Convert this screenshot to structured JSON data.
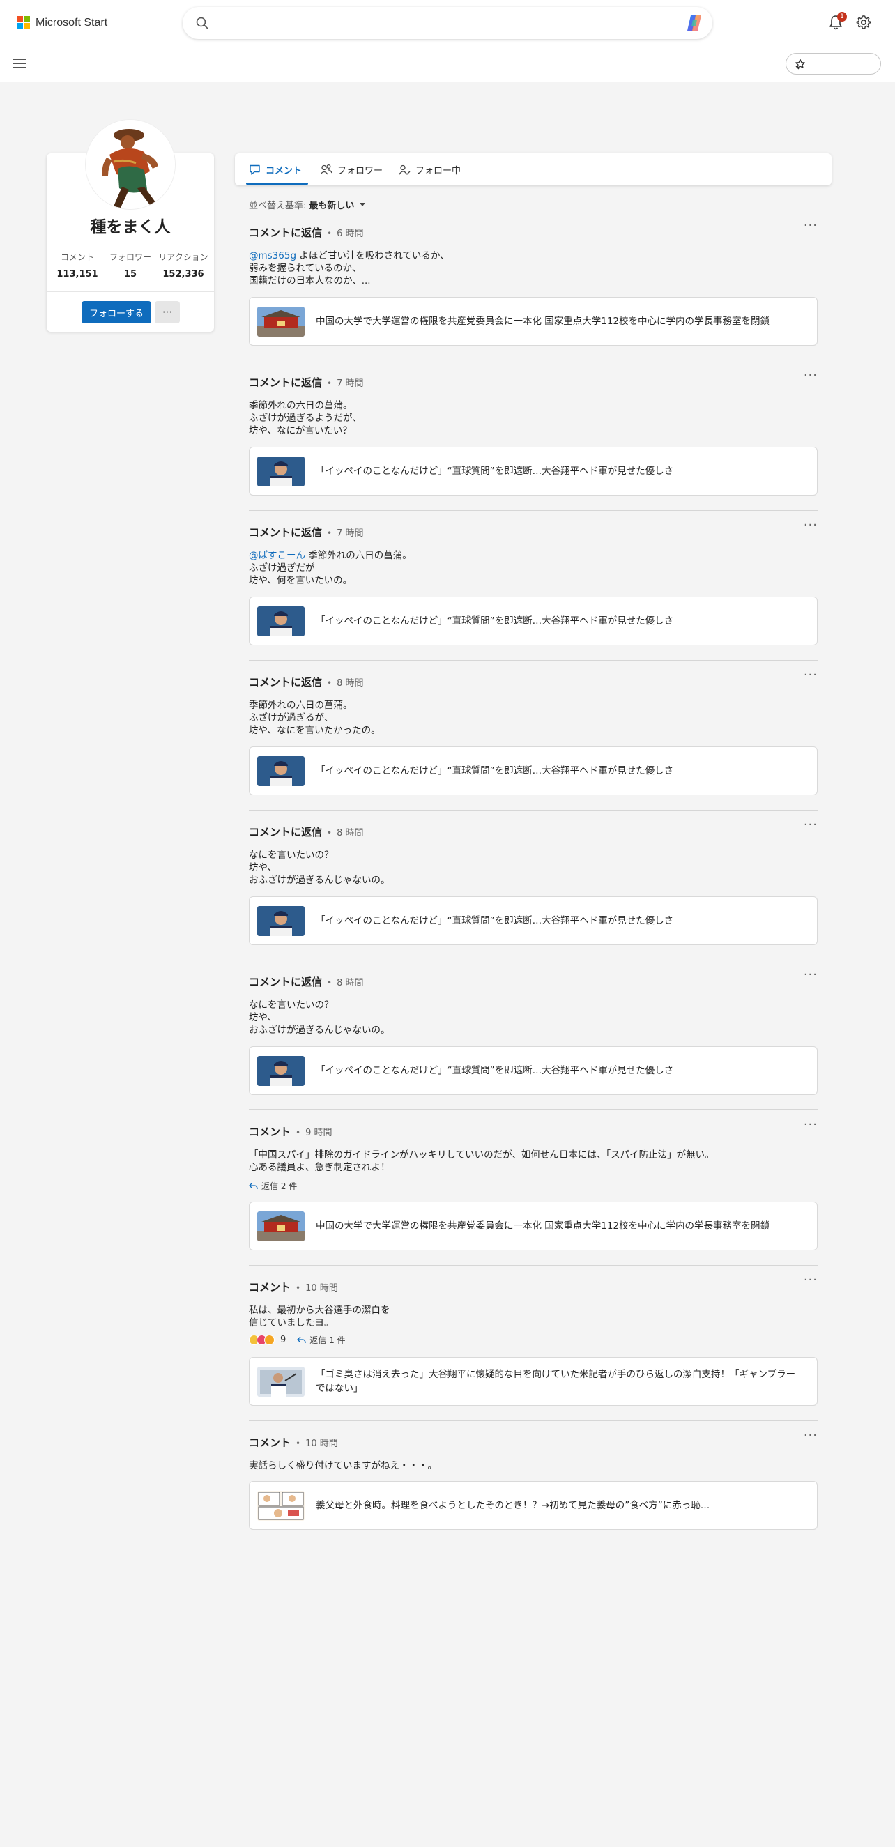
{
  "header": {
    "brand": "Microsoft Start",
    "brand_colors": [
      "#f25022",
      "#7fba00",
      "#00a4ef",
      "#ffb900"
    ],
    "search_icon": "search-icon",
    "copilot_icon": "copilot-icon",
    "notification_count": "1",
    "settings_icon": "gear-icon"
  },
  "subheader": {
    "menu_icon": "hamburger-icon",
    "favorites_icon": "star-icon"
  },
  "profile": {
    "name": "種をまく人",
    "stats": [
      {
        "label": "コメント",
        "value": "113,151"
      },
      {
        "label": "フォロワー",
        "value": "15"
      },
      {
        "label": "リアクション",
        "value": "152,336"
      }
    ],
    "follow_label": "フォローする",
    "more_label": "···"
  },
  "tabs": [
    {
      "label": "コメント",
      "icon": "comment-icon",
      "active": true
    },
    {
      "label": "フォロワー",
      "icon": "followers-icon",
      "active": false
    },
    {
      "label": "フォロー中",
      "icon": "following-icon",
      "active": false
    }
  ],
  "sort": {
    "label": "並べ替え基準:",
    "value": "最も新しい"
  },
  "feed": [
    {
      "type": "コメントに返信",
      "time": "6 時間",
      "mention": "@ms365g",
      "text": " よほど甘い汁を吸わされているか、\n弱みを握られているのか、\n国籍だけの日本人なのか、...",
      "article": "中国の大学で大学運営の権限を共産党委員会に一本化 国家重点大学112校を中心に学内の学長事務室を閉鎖",
      "thumb": "gate"
    },
    {
      "type": "コメントに返信",
      "time": "7 時間",
      "mention": "",
      "text": "季節外れの六日の菖蒲。\nふざけが過ぎるようだが、\n坊や、なにが言いたい？",
      "article": "「イッペイのことなんだけど」“直球質問”を即遮断…大谷翔平ヘド軍が見せた優しさ",
      "thumb": "player"
    },
    {
      "type": "コメントに返信",
      "time": "7 時間",
      "mention": "@ぱすこーん",
      "text": " 季節外れの六日の菖蒲。\nふざけ過ぎだが\n坊や、何を言いたいの。",
      "article": "「イッペイのことなんだけど」“直球質問”を即遮断…大谷翔平ヘド軍が見せた優しさ",
      "thumb": "player"
    },
    {
      "type": "コメントに返信",
      "time": "8 時間",
      "mention": "",
      "text": "季節外れの六日の菖蒲。\nふざけが過ぎるが、\n坊や、なにを言いたかったの。",
      "article": "「イッペイのことなんだけど」“直球質問”を即遮断…大谷翔平ヘド軍が見せた優しさ",
      "thumb": "player"
    },
    {
      "type": "コメントに返信",
      "time": "8 時間",
      "mention": "",
      "text": "なにを言いたいの？\n坊や、\nおふざけが過ぎるんじゃないの。",
      "article": "「イッペイのことなんだけど」“直球質問”を即遮断…大谷翔平ヘド軍が見せた優しさ",
      "thumb": "player"
    },
    {
      "type": "コメントに返信",
      "time": "8 時間",
      "mention": "",
      "text": "なにを言いたいの？\n坊や、\nおふざけが過ぎるんじゃないの。",
      "article": "「イッペイのことなんだけど」“直球質問”を即遮断…大谷翔平ヘド軍が見せた優しさ",
      "thumb": "player"
    },
    {
      "type": "コメント",
      "time": "9 時間",
      "mention": "",
      "text": "「中国スパイ」排除のガイドラインがハッキリしていいのだが、如何せん日本には、「スパイ防止法」が無い。\n心ある議員よ、急ぎ制定されよ！",
      "replies": "返信 2 件",
      "article": "中国の大学で大学運営の権限を共産党委員会に一本化 国家重点大学112校を中心に学内の学長事務室を閉鎖",
      "thumb": "gate"
    },
    {
      "type": "コメント",
      "time": "10 時間",
      "mention": "",
      "text": "私は、最初から大谷選手の潔白を\n信じていましたヨ。",
      "reaction_count": "9",
      "replies": "返信 1 件",
      "article": "「ゴミ臭さは消え去った」大谷翔平に懐疑的な目を向けていた米記者が手のひら返しの潔白支持！「ギャンブラーではない」",
      "thumb": "batter"
    },
    {
      "type": "コメント",
      "time": "10 時間",
      "mention": "",
      "text": "実話らしく盛り付けていますがねえ・・・。",
      "article": "義父母と外食時。料理を食べようとしたそのとき！？→初めて見た義母の”食べ方”に赤っ恥…",
      "thumb": "manga"
    }
  ]
}
